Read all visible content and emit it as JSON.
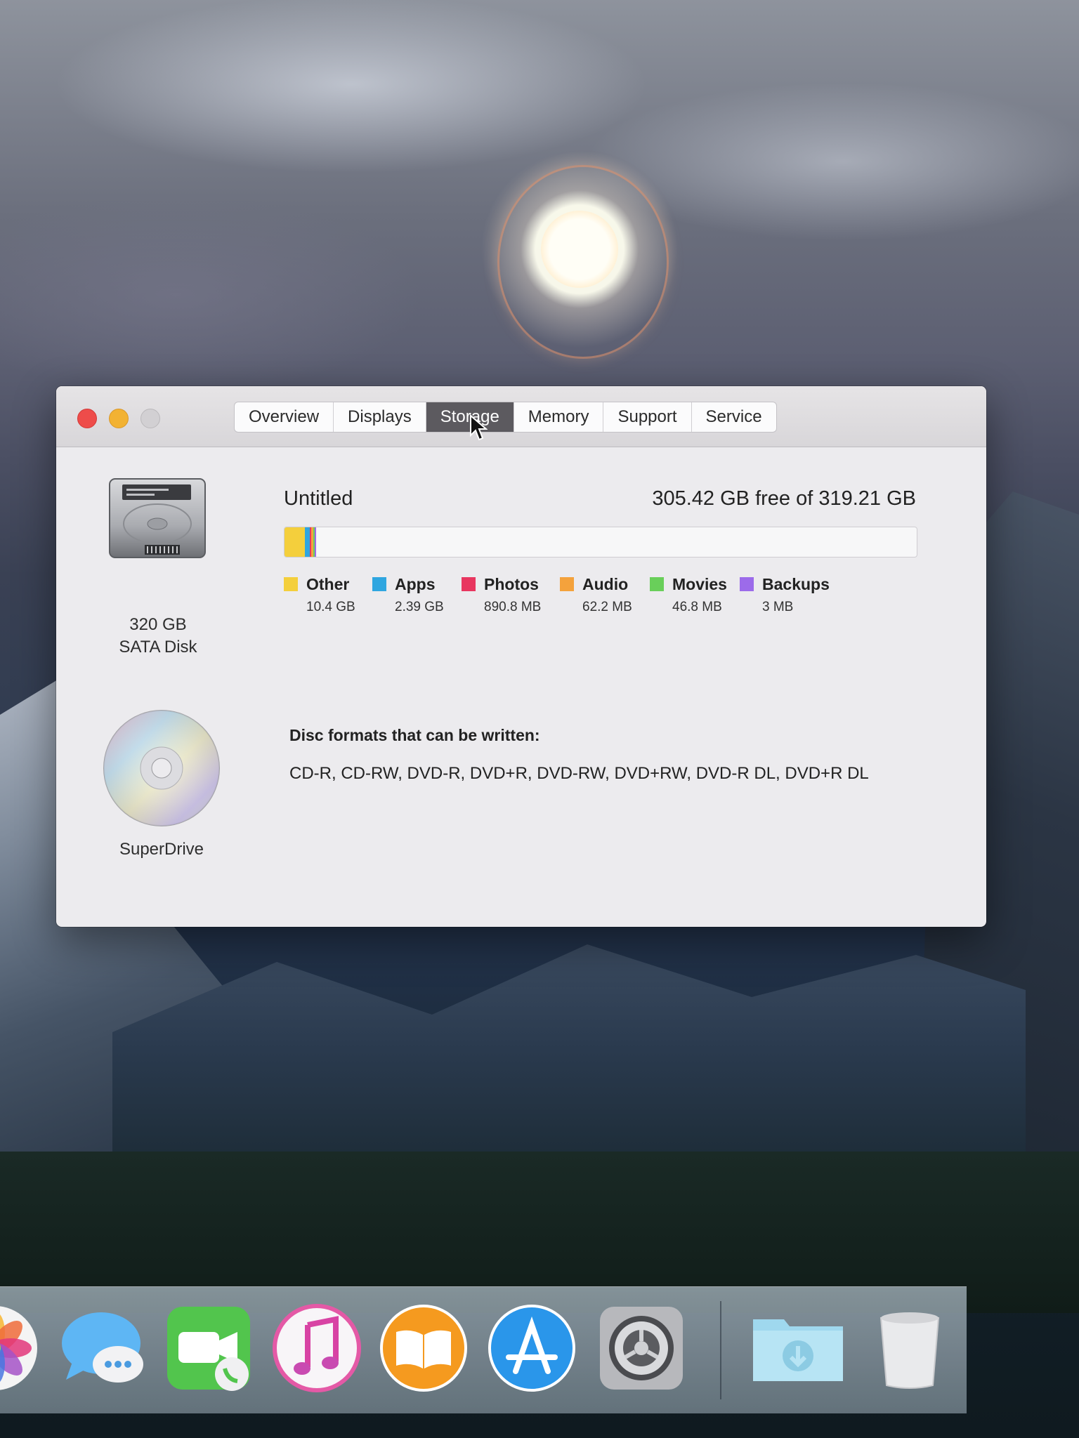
{
  "window": {
    "tabs": [
      "Overview",
      "Displays",
      "Storage",
      "Memory",
      "Support",
      "Service"
    ],
    "active_tab": "Storage"
  },
  "hdd": {
    "icon": "hard-disk-icon",
    "label_line1": "320 GB",
    "label_line2": "SATA Disk"
  },
  "volume": {
    "name": "Untitled",
    "free_text": "305.42 GB free of 319.21 GB",
    "used_fraction": 0.043
  },
  "legend": [
    {
      "name": "Other",
      "size": "10.4 GB",
      "color": "#f4cf3c"
    },
    {
      "name": "Apps",
      "size": "2.39 GB",
      "color": "#2fa6e0"
    },
    {
      "name": "Photos",
      "size": "890.8 MB",
      "color": "#e8365f"
    },
    {
      "name": "Audio",
      "size": "62.2 MB",
      "color": "#f4a23c"
    },
    {
      "name": "Movies",
      "size": "46.8 MB",
      "color": "#69cf5a"
    },
    {
      "name": "Backups",
      "size": "3 MB",
      "color": "#9c6bea"
    }
  ],
  "superdrive": {
    "icon": "optical-disc-icon",
    "label": "SuperDrive"
  },
  "disc": {
    "heading": "Disc formats that can be written:",
    "formats": "CD-R, CD-RW, DVD-R, DVD+R, DVD-RW, DVD+RW, DVD-R DL, DVD+R DL"
  },
  "dock": {
    "apps": [
      "photos-icon",
      "messages-icon",
      "facetime-icon",
      "itunes-icon",
      "ibooks-icon",
      "app-store-icon",
      "system-preferences-icon",
      "downloads-folder-icon",
      "trash-icon"
    ]
  }
}
